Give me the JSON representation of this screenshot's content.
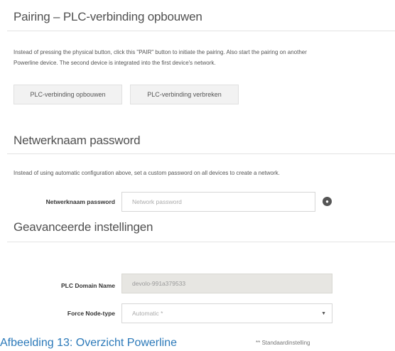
{
  "pairing": {
    "title": "Pairing – PLC-verbinding opbouwen",
    "description_line1": "Instead of pressing the physical button, click this \"PAIR\" button to initiate the pairing. Also start the pairing on another",
    "description_line2": "Powerline device. The second device is integrated into the first device's network.",
    "button_build": "PLC-verbinding opbouwen",
    "button_leave": "PLC-verbinding verbreken"
  },
  "network_password": {
    "title": "Netwerknaam password",
    "description": "Instead of using automatic configuration above, set a custom password on all devices to create a network.",
    "label": "Netwerknaam password",
    "placeholder": "Network password",
    "eye_icon": "eye-icon"
  },
  "advanced": {
    "title": "Geavanceerde instellingen",
    "domain_label": "PLC Domain Name",
    "domain_value": "devolo-991a379533",
    "node_type_label": "Force Node-type",
    "node_type_value": "Automatic *",
    "default_note": "** Standaardinstelling"
  },
  "caption": "Afbeelding 13: Overzicht Powerline"
}
